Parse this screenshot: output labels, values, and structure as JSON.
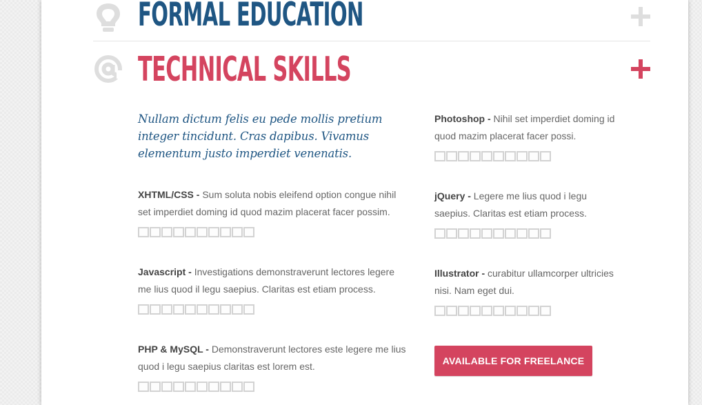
{
  "sections": {
    "education": {
      "title": "Formal Education",
      "icon": "lightbulb-icon",
      "toggle_icon": "plus-icon"
    },
    "technical": {
      "title": "Technical Skills",
      "icon": "at-sign-icon",
      "toggle_icon": "plus-icon"
    }
  },
  "intro": "Nullam dictum felis eu pede mollis pretium integer tincidunt. Cras dapibus. Vivamus elementum justo imperdiet venenatis.",
  "skills": [
    {
      "name": "XHTML/CSS -",
      "desc": " Sum soluta nobis eleifend option congue nihil set imperdiet doming id quod mazim placerat facer possim.",
      "rating": 0,
      "max": 10
    },
    {
      "name": "Javascript -",
      "desc": " Investigations demonstraverunt lectores legere me lius quod il legu saepius. Claritas est etiam process.",
      "rating": 0,
      "max": 10
    },
    {
      "name": "PHP & MySQL -",
      "desc": " Demonstraverunt lectores este legere me lius quod i legu saepius claritas est lorem est.",
      "rating": 0,
      "max": 10
    },
    {
      "name": "Photoshop -",
      "desc": " Nihil set imperdiet doming id quod mazim placerat facer possi.",
      "rating": 0,
      "max": 10
    },
    {
      "name": "jQuery -",
      "desc": " Legere me lius quod i legu saepius. Claritas est etiam process.",
      "rating": 0,
      "max": 10
    },
    {
      "name": "Illustrator -",
      "desc": " curabitur ullamcorper ultricies nisi. Nam eget dui.",
      "rating": 0,
      "max": 10
    }
  ],
  "freelance_button": "Available for Freelance",
  "colors": {
    "blue": "#1f5683",
    "accent": "#d4445f",
    "icon_grey": "#dedede"
  }
}
